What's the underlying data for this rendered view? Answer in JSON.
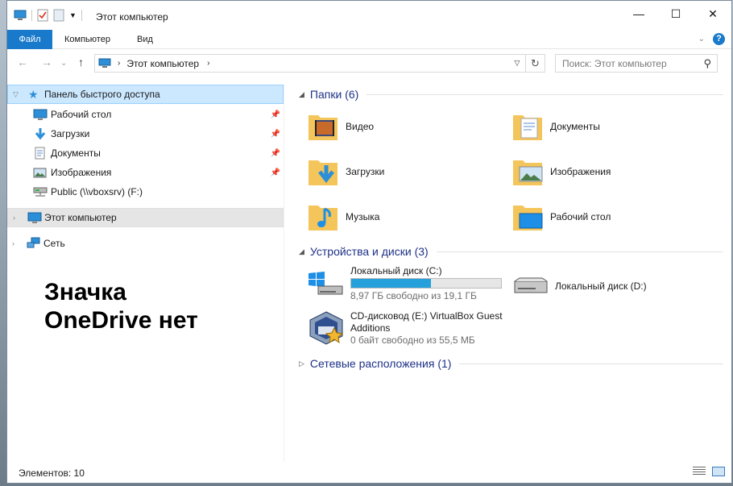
{
  "window": {
    "title": "Этот компьютер",
    "minimize": "—",
    "maximize": "☐",
    "close": "✕"
  },
  "ribbon": {
    "tabs": [
      "Файл",
      "Компьютер",
      "Вид"
    ],
    "help": "?"
  },
  "address": {
    "path": "Этот компьютер",
    "search_placeholder": "Поиск: Этот компьютер"
  },
  "nav": {
    "quick_access": "Панель быстрого доступа",
    "items": [
      {
        "label": "Рабочий стол",
        "icon": "desktop-icon",
        "pinned": true
      },
      {
        "label": "Загрузки",
        "icon": "downloads-icon",
        "pinned": true
      },
      {
        "label": "Документы",
        "icon": "documents-icon",
        "pinned": true
      },
      {
        "label": "Изображения",
        "icon": "pictures-icon",
        "pinned": true
      },
      {
        "label": "Public (\\\\vboxsrv) (F:)",
        "icon": "network-drive-icon",
        "pinned": false
      }
    ],
    "this_pc": "Этот компьютер",
    "network": "Сеть"
  },
  "overlay_note": [
    "Значка",
    "OneDrive нет"
  ],
  "content": {
    "folders_header": "Папки (6)",
    "folders": [
      {
        "label": "Видео",
        "icon": "videos-folder-icon"
      },
      {
        "label": "Документы",
        "icon": "documents-folder-icon"
      },
      {
        "label": "Загрузки",
        "icon": "downloads-folder-icon"
      },
      {
        "label": "Изображения",
        "icon": "pictures-folder-icon"
      },
      {
        "label": "Музыка",
        "icon": "music-folder-icon"
      },
      {
        "label": "Рабочий стол",
        "icon": "desktop-folder-icon"
      }
    ],
    "devices_header": "Устройства и диски (3)",
    "drive_c": {
      "name": "Локальный диск (C:)",
      "free": "8,97 ГБ свободно из 19,1 ГБ",
      "used_fraction": 0.53
    },
    "drive_d": {
      "name": "Локальный диск (D:)"
    },
    "drive_e": {
      "name_line1": "CD-дисковод (E:) VirtualBox Guest",
      "name_line2": "Additions",
      "free": "0 байт свободно из 55,5 МБ"
    },
    "network_header": "Сетевые расположения (1)"
  },
  "status": {
    "items_count": "Элементов: 10"
  },
  "colors": {
    "accent": "#1979ca",
    "folder": "#f4c55a",
    "drive_bar": "#26a0da",
    "group_header": "#1e3287"
  }
}
